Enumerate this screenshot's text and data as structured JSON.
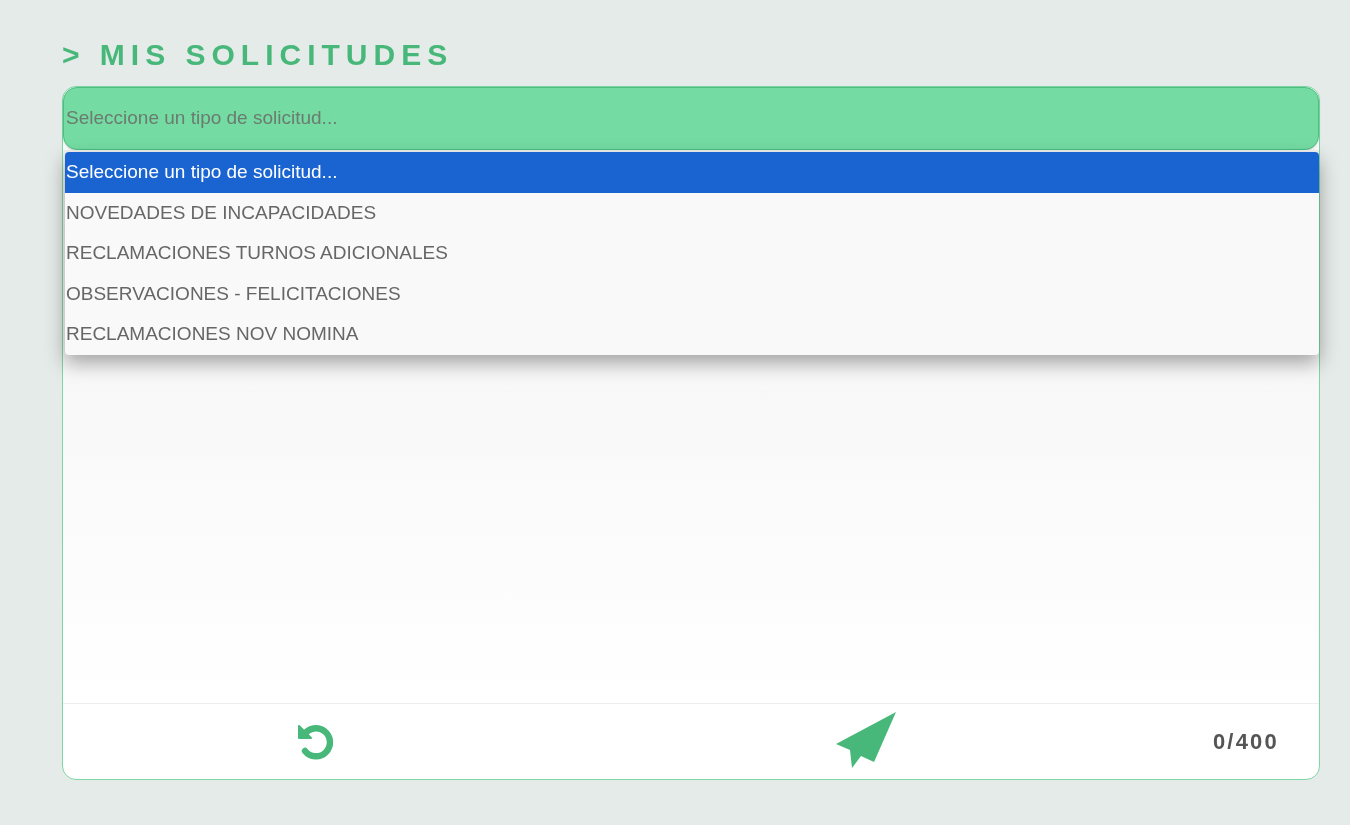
{
  "heading": "> MIS SOLICITUDES",
  "select": {
    "placeholder": "Seleccione un tipo de solicitud...",
    "expanded": true
  },
  "options": [
    {
      "label": "Seleccione un tipo de solicitud...",
      "selected": true
    },
    {
      "label": "NOVEDADES DE INCAPACIDADES",
      "selected": false
    },
    {
      "label": "RECLAMACIONES TURNOS ADICIONALES",
      "selected": false
    },
    {
      "label": "OBSERVACIONES - FELICITACIONES",
      "selected": false
    },
    {
      "label": "RECLAMACIONES NOV NOMINA",
      "selected": false
    }
  ],
  "counter": "0/400"
}
